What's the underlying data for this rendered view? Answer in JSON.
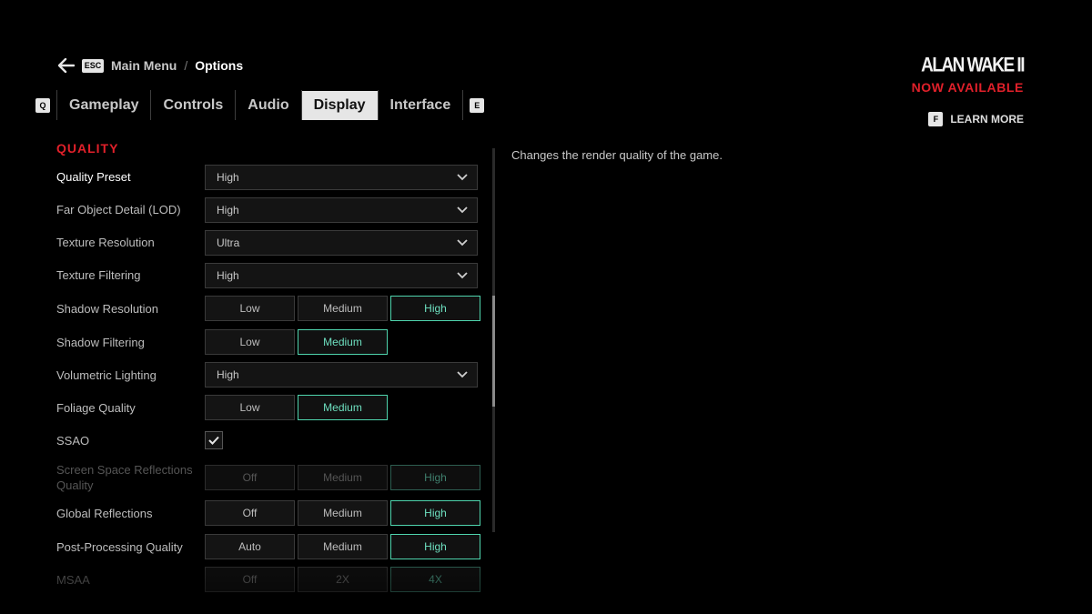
{
  "breadcrumb": {
    "esc_key": "ESC",
    "main_menu": "Main Menu",
    "separator": "/",
    "current": "Options"
  },
  "tabs": {
    "prev_key": "Q",
    "next_key": "E",
    "items": [
      "Gameplay",
      "Controls",
      "Audio",
      "Display",
      "Interface"
    ],
    "active": "Display"
  },
  "promo": {
    "logo": "ALAN WAKE II",
    "availability": "NOW AVAILABLE",
    "learn_key": "F",
    "learn_label": "LEARN MORE"
  },
  "section": {
    "title": "QUALITY"
  },
  "settings": {
    "quality_preset": {
      "label": "Quality Preset",
      "value": "High"
    },
    "far_object_detail": {
      "label": "Far Object Detail (LOD)",
      "value": "High"
    },
    "texture_resolution": {
      "label": "Texture Resolution",
      "value": "Ultra"
    },
    "texture_filtering": {
      "label": "Texture Filtering",
      "value": "High"
    },
    "shadow_resolution": {
      "label": "Shadow Resolution",
      "options": [
        "Low",
        "Medium",
        "High"
      ],
      "selected": "High"
    },
    "shadow_filtering": {
      "label": "Shadow Filtering",
      "options": [
        "Low",
        "Medium"
      ],
      "selected": "Medium"
    },
    "volumetric_lighting": {
      "label": "Volumetric Lighting",
      "value": "High"
    },
    "foliage_quality": {
      "label": "Foliage Quality",
      "options": [
        "Low",
        "Medium"
      ],
      "selected": "Medium"
    },
    "ssao": {
      "label": "SSAO",
      "checked": true
    },
    "ssr_quality": {
      "label": "Screen Space Reflections Quality",
      "options": [
        "Off",
        "Medium",
        "High"
      ],
      "selected": "High",
      "disabled": true
    },
    "global_reflections": {
      "label": "Global Reflections",
      "options": [
        "Off",
        "Medium",
        "High"
      ],
      "selected": "High"
    },
    "post_processing": {
      "label": "Post-Processing Quality",
      "options": [
        "Auto",
        "Medium",
        "High"
      ],
      "selected": "High"
    },
    "msaa": {
      "label": "MSAA",
      "options": [
        "Off",
        "2X",
        "4X"
      ],
      "selected": "4X",
      "disabled": true
    }
  },
  "description": "Changes the render quality of the game.",
  "colors": {
    "accent_red": "#e0202a",
    "selected_teal": "#4fd4ad",
    "background": "#000000"
  }
}
